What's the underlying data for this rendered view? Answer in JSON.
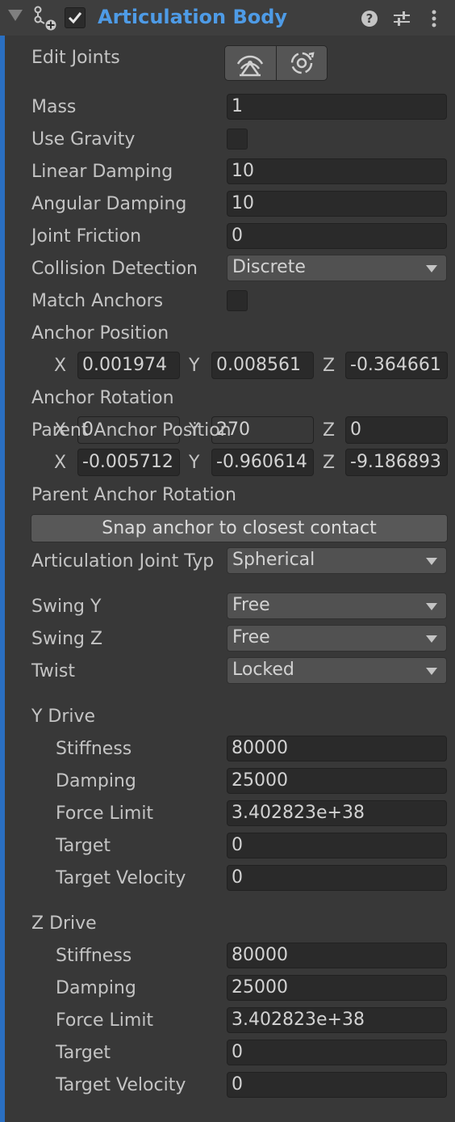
{
  "header": {
    "title": "Articulation Body"
  },
  "edit_joints": {
    "label": "Edit Joints"
  },
  "props": {
    "mass": {
      "label": "Mass",
      "value": "1"
    },
    "use_gravity": {
      "label": "Use Gravity",
      "checked": false
    },
    "linear_damping": {
      "label": "Linear Damping",
      "value": "10"
    },
    "angular_damping": {
      "label": "Angular Damping",
      "value": "10"
    },
    "joint_friction": {
      "label": "Joint Friction",
      "value": "0"
    },
    "collision_detection": {
      "label": "Collision Detection",
      "value": "Discrete"
    },
    "match_anchors": {
      "label": "Match Anchors",
      "checked": false
    }
  },
  "anchor_position": {
    "label": "Anchor Position",
    "x": "0.001974",
    "y": "0.008561",
    "z": "-0.364661"
  },
  "anchor_rotation": {
    "label": "Anchor Rotation",
    "x": "0",
    "y": "270",
    "z": "0"
  },
  "parent_anchor_position": {
    "label": "Parent Anchor Position",
    "x": "-0.005712",
    "y": "-0.960614",
    "z": "-9.186893"
  },
  "parent_anchor_rotation": {
    "label": "Parent Anchor Rotation"
  },
  "axis_labels": {
    "x": "X",
    "y": "Y",
    "z": "Z"
  },
  "snap_button": "Snap anchor to closest contact",
  "joint_type": {
    "label": "Articulation Joint Typ",
    "value": "Spherical"
  },
  "swing_y": {
    "label": "Swing Y",
    "value": "Free"
  },
  "swing_z": {
    "label": "Swing Z",
    "value": "Free"
  },
  "twist": {
    "label": "Twist",
    "value": "Locked"
  },
  "y_drive": {
    "label": "Y Drive",
    "stiffness": {
      "label": "Stiffness",
      "value": "80000"
    },
    "damping": {
      "label": "Damping",
      "value": "25000"
    },
    "force_limit": {
      "label": "Force Limit",
      "value": "3.402823e+38"
    },
    "target": {
      "label": "Target",
      "value": "0"
    },
    "target_velocity": {
      "label": "Target Velocity",
      "value": "0"
    }
  },
  "z_drive": {
    "label": "Z Drive",
    "stiffness": {
      "label": "Stiffness",
      "value": "80000"
    },
    "damping": {
      "label": "Damping",
      "value": "25000"
    },
    "force_limit": {
      "label": "Force Limit",
      "value": "3.402823e+38"
    },
    "target": {
      "label": "Target",
      "value": "0"
    },
    "target_velocity": {
      "label": "Target Velocity",
      "value": "0"
    }
  },
  "colors": {
    "accent": "#2a6fc2",
    "title": "#4e9be6",
    "background": "#383838"
  },
  "icons": [
    "foldout-arrow-icon",
    "articulation-component-icon",
    "checkmark-icon",
    "help-icon",
    "preset-sliders-icon",
    "more-options-icon",
    "edit-anchor-icon",
    "edit-rotation-icon"
  ]
}
